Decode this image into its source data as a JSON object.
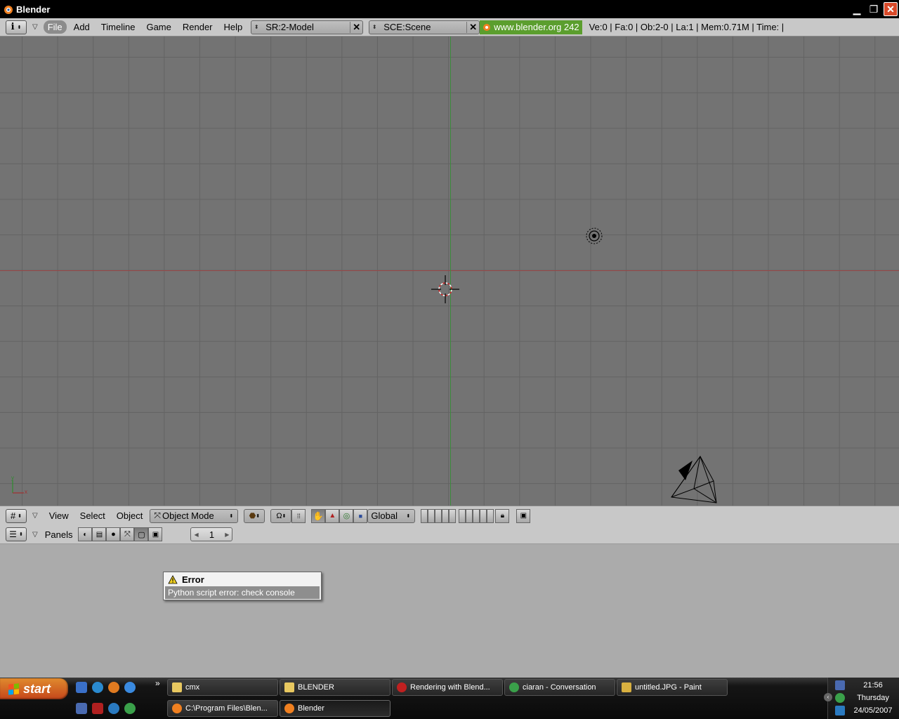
{
  "window": {
    "title": "Blender"
  },
  "info_header": {
    "menus": [
      "File",
      "Add",
      "Timeline",
      "Game",
      "Render",
      "Help"
    ],
    "screen_field": "SR:2-Model",
    "scene_field": "SCE:Scene",
    "website": "www.blender.org 242",
    "stats": "Ve:0 | Fa:0 | Ob:2-0 | La:1  | Mem:0.71M  | Time: |"
  },
  "viewport_header": {
    "menus": [
      "View",
      "Select",
      "Object"
    ],
    "mode": "Object Mode",
    "orientation": "Global"
  },
  "buttons_header": {
    "panels_label": "Panels",
    "frame": "1"
  },
  "error": {
    "title": "Error",
    "message": "Python script error: check console"
  },
  "taskbar": {
    "start_label": "start",
    "chevron": "»",
    "row1": [
      {
        "label": "cmx",
        "icon": "folder-icon"
      },
      {
        "label": "BLENDER",
        "icon": "folder-icon"
      },
      {
        "label": "Rendering with Blend...",
        "icon": "acrobat-icon"
      },
      {
        "label": "ciaran - Conversation",
        "icon": "messenger-icon"
      },
      {
        "label": "untitled.JPG - Paint",
        "icon": "paint-icon"
      }
    ],
    "row2": [
      {
        "label": "C:\\Program Files\\Blen...",
        "icon": "blender-icon"
      },
      {
        "label": "Blender",
        "icon": "blender-icon"
      }
    ],
    "clock": {
      "time": "21:56",
      "day": "Thursday",
      "date": "24/05/2007"
    }
  },
  "colors": {
    "viewport_bg": "#737373",
    "grid": "#636363",
    "x_axis": "#9A4646",
    "y_axis": "#3C8C3C",
    "website_bg": "#5B9E2E",
    "start_button": "#C5461A"
  }
}
